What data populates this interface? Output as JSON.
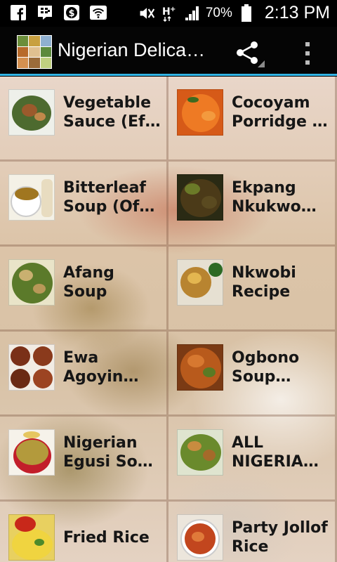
{
  "status_bar": {
    "icons": [
      "facebook-icon",
      "bbm-icon",
      "s-app-icon",
      "wifi-icon",
      "mute-icon",
      "network-h-icon",
      "signal-icon",
      "battery-icon"
    ],
    "battery": "70%",
    "time": "2:13 PM"
  },
  "app_bar": {
    "title": "Nigerian Delicacies",
    "actions": [
      "share-icon",
      "overflow-menu-icon"
    ],
    "accent_color": "#33b5e5"
  },
  "recipes": [
    {
      "label": "Vegetable Sauce (Efo Riro)",
      "thumb": "vegetable-sauce"
    },
    {
      "label": "Cocoyam Porridge / Pottage",
      "thumb": "cocoyam-porridge"
    },
    {
      "label": "Bitterleaf Soup (Ofe Onugbu)",
      "thumb": "bitterleaf-soup"
    },
    {
      "label": "Ekpang Nkukwo Recipe",
      "thumb": "ekpang-nkukwo"
    },
    {
      "label": "Afang Soup",
      "thumb": "afang-soup"
    },
    {
      "label": "Nkwobi Recipe",
      "thumb": "nkwobi"
    },
    {
      "label": "Ewa Agoyin (Stewed Beans)",
      "thumb": "ewa-agoyin"
    },
    {
      "label": "Ogbono Soup (Draw Soup)",
      "thumb": "ogbono-soup"
    },
    {
      "label": "Nigerian Egusi Soup Recipe",
      "thumb": "egusi-soup"
    },
    {
      "label": "ALL NIGERIAN RECIPES",
      "thumb": "all-recipes"
    },
    {
      "label": "Fried Rice",
      "thumb": "fried-rice"
    },
    {
      "label": "Party Jollof Rice",
      "thumb": "jollof-rice"
    }
  ]
}
